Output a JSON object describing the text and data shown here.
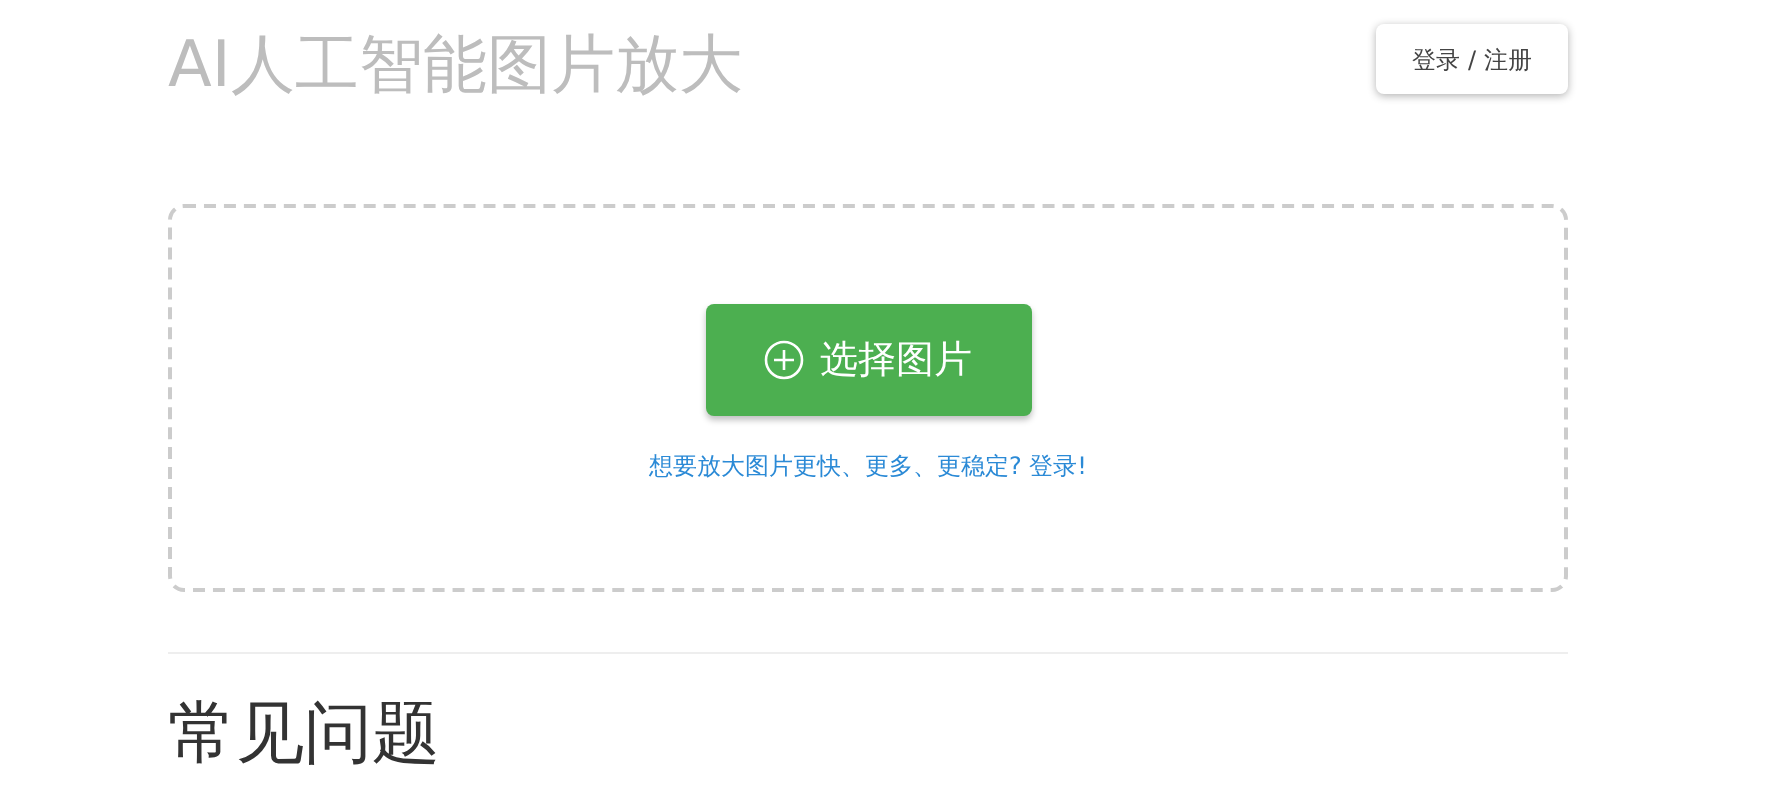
{
  "header": {
    "title": "AI人工智能图片放大",
    "login_button": "登录 / 注册"
  },
  "upload": {
    "button": "选择图片",
    "hint_link": "想要放大图片更快、更多、更稳定? 登录!"
  },
  "faq": {
    "heading": "常见问题"
  }
}
